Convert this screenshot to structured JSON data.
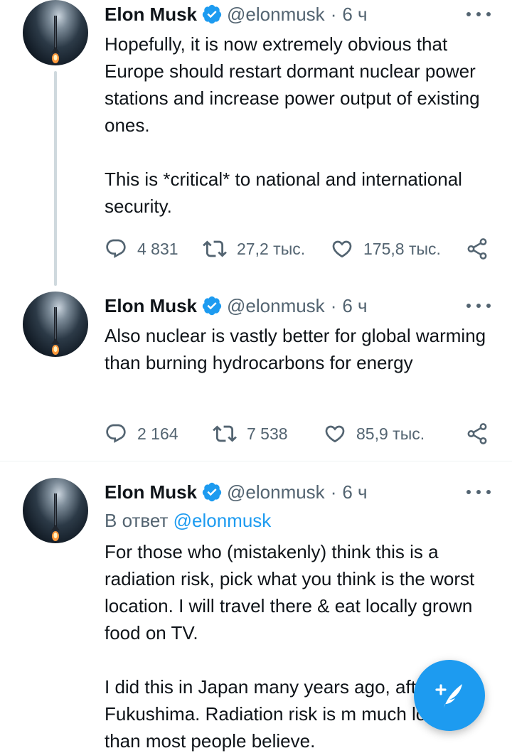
{
  "colors": {
    "accent": "#1d9bf0",
    "text": "#0f1419",
    "secondary": "#536471",
    "thread_line": "#cfd9de"
  },
  "tweets": [
    {
      "name": "Elon Musk",
      "handle": "@elonmusk",
      "separator": "·",
      "time": "6 ч",
      "verified": true,
      "text": "Hopefully, it is now extremely obvious that Europe should restart dormant nuclear power stations and increase power output of existing ones.\n\nThis is *critical* to national and international security.",
      "replies": "4 831",
      "retweets": "27,2 тыс.",
      "likes": "175,8 тыс."
    },
    {
      "name": "Elon Musk",
      "handle": "@elonmusk",
      "separator": "·",
      "time": "6 ч",
      "verified": true,
      "text": "Also nuclear is vastly better for global warming than burning hydrocarbons for energy",
      "replies": "2 164",
      "retweets": "7 538",
      "likes": "85,9 тыс."
    },
    {
      "name": "Elon Musk",
      "handle": "@elonmusk",
      "separator": "·",
      "time": "6 ч",
      "verified": true,
      "reply_prefix": "В ответ",
      "reply_mention": "@elonmusk",
      "text": "For those who (mistakenly) think this is a radiation risk, pick what you think is the worst location. I will travel there & eat locally grown food on TV.\n\nI did this in Japan many years ago, after Fukushima. Radiation risk is m much lower than most people believe."
    }
  ],
  "icons": {
    "reply": "reply-icon",
    "retweet": "retweet-icon",
    "like": "heart-icon",
    "share": "share-icon",
    "more": "more-options-icon",
    "verified": "verified-badge-icon",
    "compose": "compose-tweet-icon"
  }
}
